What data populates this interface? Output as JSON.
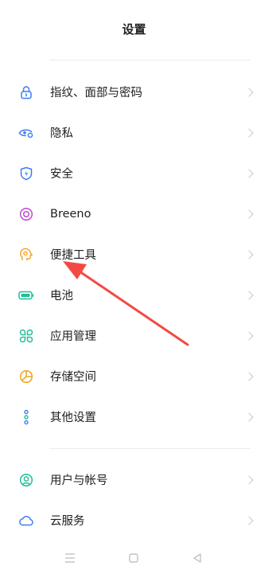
{
  "header": {
    "title": "设置"
  },
  "menu": [
    {
      "label": "指纹、面部与密码",
      "icon": "lock-icon",
      "color": "#3b7df7"
    },
    {
      "label": "隐私",
      "icon": "privacy-eye-icon",
      "color": "#3b7df7"
    },
    {
      "label": "安全",
      "icon": "security-shield-icon",
      "color": "#3b7df7"
    },
    {
      "label": "Breeno",
      "icon": "breeno-icon",
      "color": "#c04bd4"
    },
    {
      "label": "便捷工具",
      "icon": "convenience-tools-icon",
      "color": "#f3a21d"
    },
    {
      "label": "电池",
      "icon": "battery-icon",
      "color": "#1fbf95"
    },
    {
      "label": "应用管理",
      "icon": "app-management-icon",
      "color": "#1fbf95"
    },
    {
      "label": "存储空间",
      "icon": "storage-icon",
      "color": "#f3a21d"
    },
    {
      "label": "其他设置",
      "icon": "other-settings-icon",
      "color": "#3b7df7"
    },
    {
      "label": "用户与帐号",
      "icon": "user-account-icon",
      "color": "#1fbf95"
    },
    {
      "label": "云服务",
      "icon": "cloud-icon",
      "color": "#3b7df7"
    }
  ],
  "navigation": {
    "menu_icon": "menu-icon",
    "home_icon": "home-icon",
    "back_icon": "back-icon"
  },
  "annotation": {
    "arrow_color": "#f24a43",
    "arrow_target": "便捷工具"
  }
}
